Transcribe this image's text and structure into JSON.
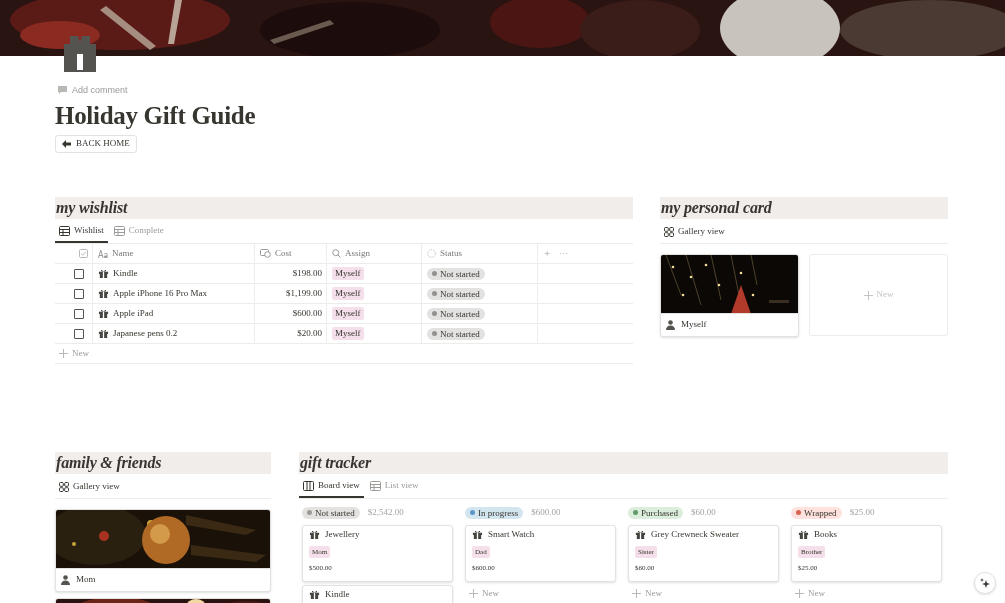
{
  "page": {
    "add_comment": "Add comment",
    "title": "Holiday Gift Guide",
    "back_button": "BACK HOME"
  },
  "wishlist": {
    "heading": "my wishlist",
    "tabs": [
      {
        "label": "Wishlist",
        "selected": true
      },
      {
        "label": "Complete",
        "selected": false
      }
    ],
    "columns": [
      {
        "label": "Name",
        "kind": "title"
      },
      {
        "label": "Cost",
        "kind": "money"
      },
      {
        "label": "Assign",
        "kind": "search"
      },
      {
        "label": "Status",
        "kind": "status"
      }
    ],
    "rows": [
      {
        "checked": false,
        "name": "Kindle",
        "cost": "$198.00",
        "assign": "Myself",
        "status": "Not started"
      },
      {
        "checked": false,
        "name": "Apple iPhone 16 Pro Max",
        "cost": "$1,199.00",
        "assign": "Myself",
        "status": "Not started"
      },
      {
        "checked": false,
        "name": "Apple iPad",
        "cost": "$600.00",
        "assign": "Myself",
        "status": "Not started"
      },
      {
        "checked": false,
        "name": "Japanese pens 0.2",
        "cost": "$20.00",
        "assign": "Myself",
        "status": "Not started"
      }
    ],
    "add_column": "+",
    "more": "···",
    "new_row": "New"
  },
  "personal_card": {
    "heading": "my personal card",
    "view": "Gallery view",
    "cards": [
      {
        "name": "Myself",
        "kind": "picture"
      }
    ],
    "new_card": "New"
  },
  "family": {
    "heading": "family & friends",
    "view": "Gallery view",
    "cards": [
      {
        "name": "Mom",
        "kind": "picture"
      },
      {
        "kind": "picture"
      }
    ]
  },
  "gift_tracker": {
    "heading": "gift tracker",
    "tabs": [
      {
        "label": "Board view",
        "selected": true,
        "kind": "board"
      },
      {
        "label": "List view",
        "selected": false,
        "kind": "table"
      }
    ],
    "groups": [
      {
        "status": "Not started",
        "color": "#9b9a97",
        "total": "$2,542.00",
        "cards": [
          {
            "title": "Jewellery",
            "person": "Mom",
            "price": "$500.00"
          },
          {
            "title": "Kindle"
          }
        ]
      },
      {
        "status": "In progress",
        "color": "#5a96c8",
        "total": "$600.00",
        "cards": [
          {
            "title": "Smart Watch",
            "person": "Dad",
            "price": "$600.00"
          }
        ],
        "new_card": "New"
      },
      {
        "status": "Purchased",
        "color": "#5f9a6b",
        "total": "$60.00",
        "cards": [
          {
            "title": "Grey Crewneck Sweater",
            "person": "Sister",
            "price": "$60.00"
          }
        ],
        "new_card": "New"
      },
      {
        "status": "Wrapped",
        "color": "#d9634f",
        "total": "$25.00",
        "cards": [
          {
            "title": "Books",
            "person": "Brother",
            "price": "$25.00"
          }
        ],
        "new_card": "New"
      }
    ]
  }
}
